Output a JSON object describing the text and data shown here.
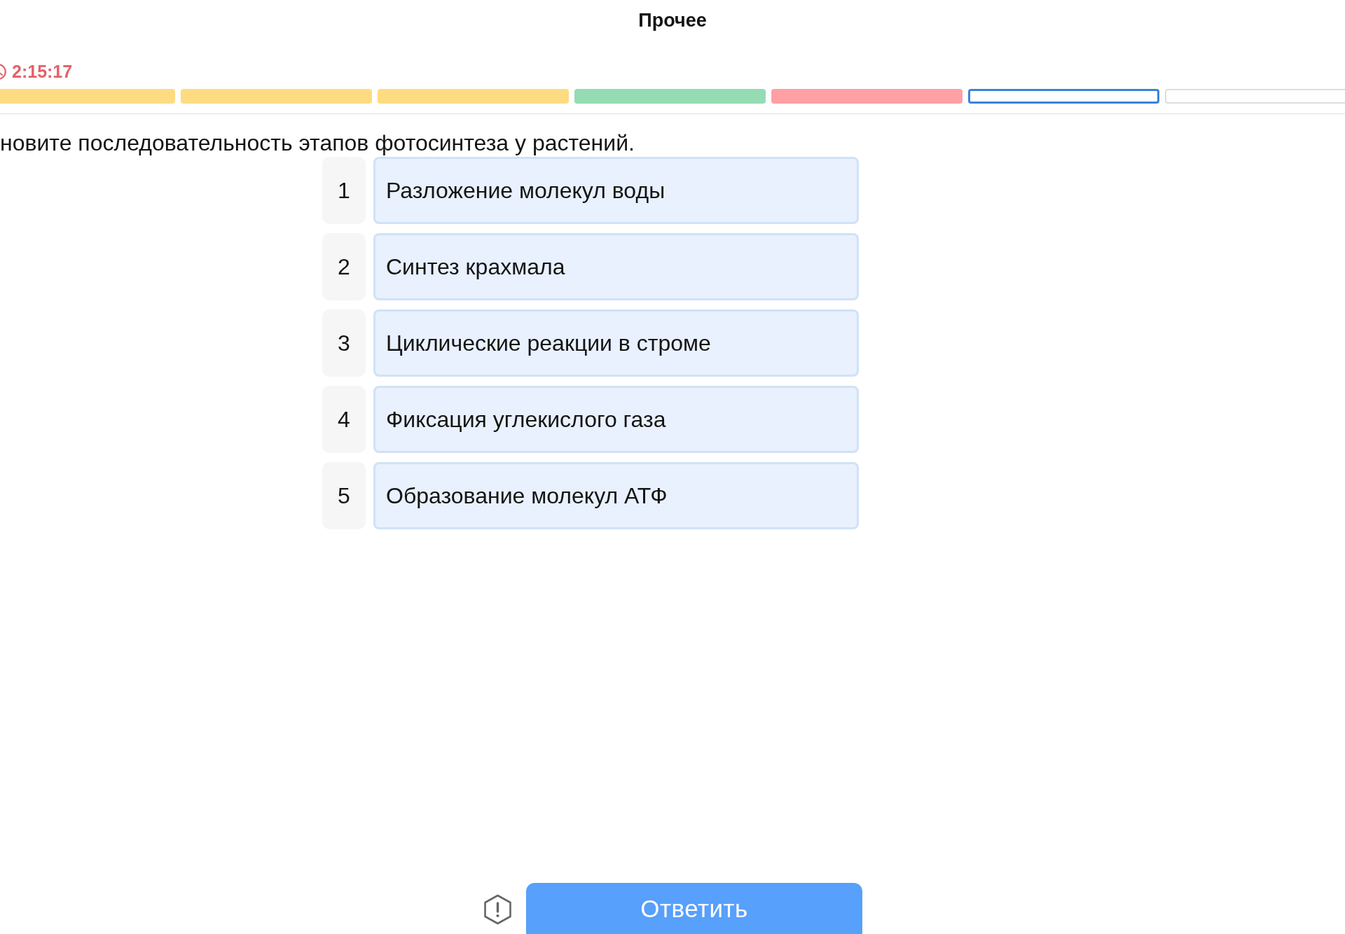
{
  "header": {
    "title": "Прочее"
  },
  "timer": {
    "time": "2:15:17"
  },
  "progress": {
    "segments": [
      {
        "color": "#fddb80",
        "selected": false
      },
      {
        "color": "#fddb80",
        "selected": false
      },
      {
        "color": "#fddb80",
        "selected": false
      },
      {
        "color": "#95dbb3",
        "selected": false
      },
      {
        "color": "#fea0a4",
        "selected": false
      },
      {
        "selected": true
      },
      {
        "selected": false
      }
    ]
  },
  "question": {
    "text": "новите последовательность этапов фотосинтеза у растений."
  },
  "options": [
    {
      "number": "1",
      "text": "Разложение молекул воды"
    },
    {
      "number": "2",
      "text": "Синтез крахмала"
    },
    {
      "number": "3",
      "text": "Циклические реакции в строме"
    },
    {
      "number": "4",
      "text": "Фиксация углекислого газа"
    },
    {
      "number": "5",
      "text": "Образование молекул АТФ"
    }
  ],
  "footer": {
    "submit_button": "Ответить"
  }
}
